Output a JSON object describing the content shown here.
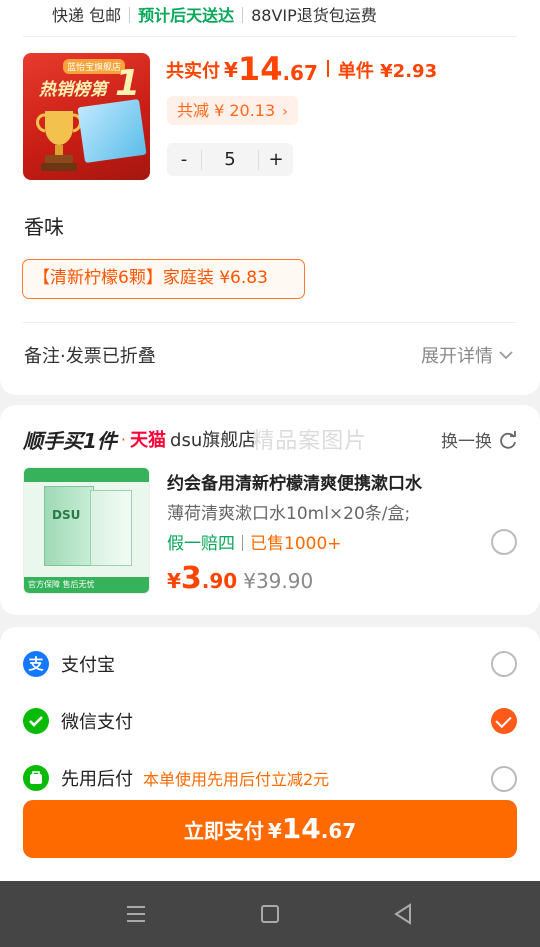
{
  "shipping": {
    "method": "快递 包邮",
    "delivery": "预计后天送达",
    "vip": "88VIP退货包运费"
  },
  "product": {
    "image_badge": "蓝怡宝旗舰店",
    "image_rank_text": "热销榜第",
    "image_rank_number": "1",
    "total_label": "共实付",
    "currency": "¥",
    "price_int": "14",
    "price_dec": ".67",
    "unit_price": "单件 ¥2.93",
    "discount": "共减 ¥ 20.13",
    "quantity": "5",
    "minus": "-",
    "plus": "+"
  },
  "flavor": {
    "label": "香味",
    "option": "【清新柠檬6颗】家庭装  ¥6.83"
  },
  "note": {
    "label": "备注·发票已折叠",
    "expand": "展开详情"
  },
  "addon": {
    "title": "顺手买1件",
    "dot": "·",
    "tmall": "天猫",
    "store": "dsu旗舰店",
    "watermark": "精品案图片",
    "swap": "换一换",
    "name": "约会备用清新柠檬清爽便携漱口水",
    "spec": "薄荷清爽漱口水10ml×20条/盒;",
    "guarantee": "假一赔四",
    "sold": "已售1000+",
    "currency": "¥",
    "price_int": "3",
    "price_dec": ".90",
    "original_price": "¥39.90",
    "image_brand": "DSU",
    "image_footer": "官方保障 售后无忧"
  },
  "payment": {
    "alipay": "支付宝",
    "wechat": "微信支付",
    "paylater": "先用后付",
    "paylater_promo": "本单使用先用后付立减2元",
    "selected": "wechat"
  },
  "pay_button": {
    "label": "立即支付",
    "currency": "¥",
    "amount_int": "14",
    "amount_dec": ".67"
  },
  "colors": {
    "accent": "#ff6a00",
    "price": "#ff4400",
    "green": "#07a85a"
  }
}
